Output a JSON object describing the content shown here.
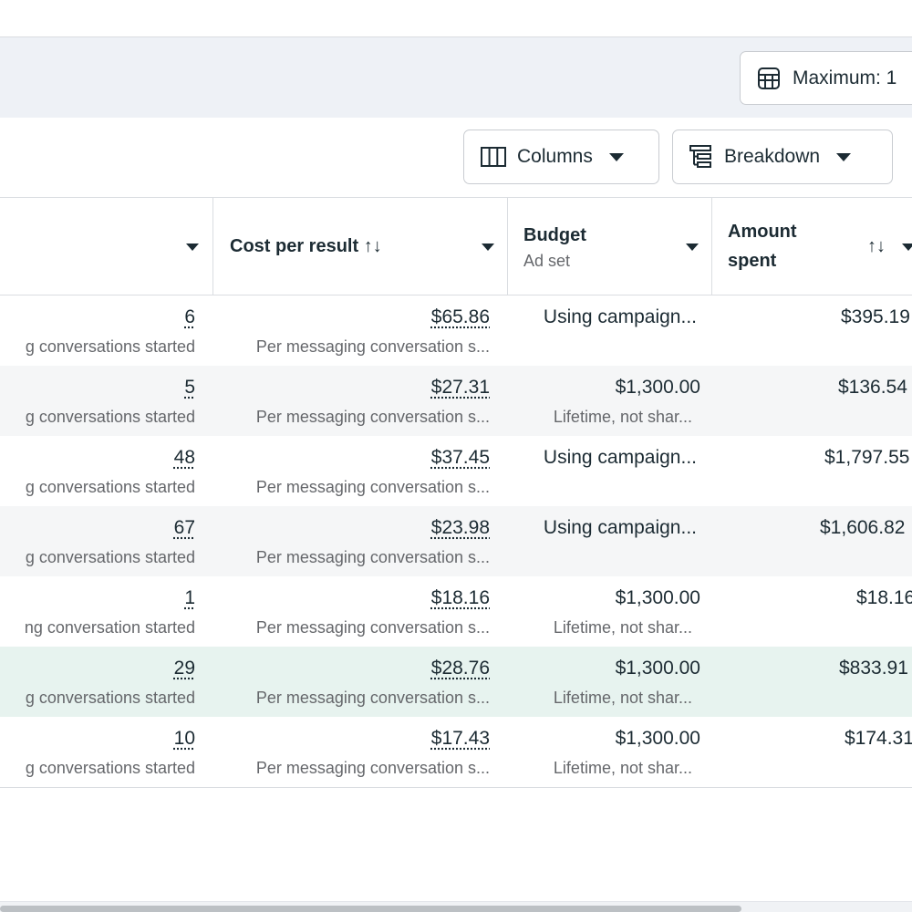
{
  "toolbar": {
    "maximum_label": "Maximum: 1",
    "columns_label": "Columns",
    "breakdown_label": "Breakdown"
  },
  "columns": {
    "results": {
      "title": ""
    },
    "cost_per_result": {
      "title": "Cost per result ↑↓"
    },
    "budget": {
      "title": "Budget",
      "subtitle": "Ad set"
    },
    "amount_spent": {
      "title_line1": "Amount",
      "title_line2": "spent",
      "sort": "↑↓"
    }
  },
  "rows": [
    {
      "results": "6",
      "results_sub": "g conversations started",
      "cpr": "$65.86",
      "cpr_sub": "Per messaging conversation s...",
      "budget": "Using campaign...",
      "budget_sub": "",
      "spent": "$395.19"
    },
    {
      "results": "5",
      "results_sub": "g conversations started",
      "cpr": "$27.31",
      "cpr_sub": "Per messaging conversation s...",
      "budget": "$1,300.00",
      "budget_sub": "Lifetime, not shar...",
      "spent": "$136.54"
    },
    {
      "results": "48",
      "results_sub": "g conversations started",
      "cpr": "$37.45",
      "cpr_sub": "Per messaging conversation s...",
      "budget": "Using campaign...",
      "budget_sub": "",
      "spent": "$1,797.55"
    },
    {
      "results": "67",
      "results_sub": "g conversations started",
      "cpr": "$23.98",
      "cpr_sub": "Per messaging conversation s...",
      "budget": "Using campaign...",
      "budget_sub": "",
      "spent": "$1,606.82"
    },
    {
      "results": "1",
      "results_sub": "ng conversation started",
      "cpr": "$18.16",
      "cpr_sub": "Per messaging conversation s...",
      "budget": "$1,300.00",
      "budget_sub": "Lifetime, not shar...",
      "spent": "$18.16"
    },
    {
      "results": "29",
      "results_sub": "g conversations started",
      "cpr": "$28.76",
      "cpr_sub": "Per messaging conversation s...",
      "budget": "$1,300.00",
      "budget_sub": "Lifetime, not shar...",
      "spent": "$833.91"
    },
    {
      "results": "10",
      "results_sub": "g conversations started",
      "cpr": "$17.43",
      "cpr_sub": "Per messaging conversation s...",
      "budget": "$1,300.00",
      "budget_sub": "Lifetime, not shar...",
      "spent": "$174.31"
    }
  ],
  "icons": {
    "maximum": "table-icon",
    "columns": "columns-icon",
    "breakdown": "breakdown-icon",
    "dropdown": "caret-down-icon"
  }
}
